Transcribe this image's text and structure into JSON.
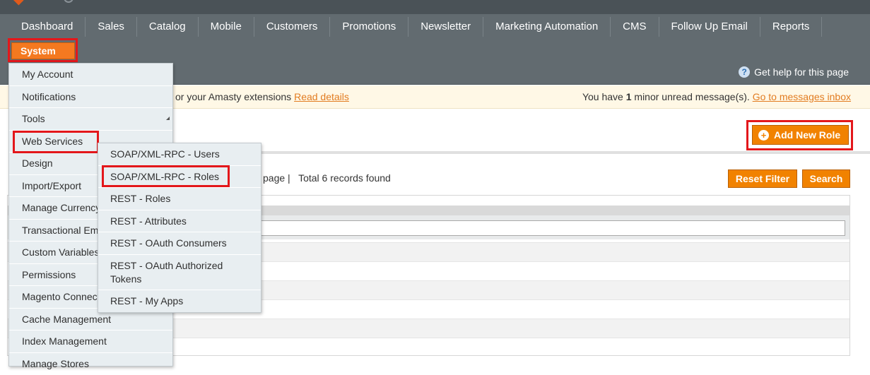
{
  "nav": {
    "items": [
      "Dashboard",
      "Sales",
      "Catalog",
      "Mobile",
      "Customers",
      "Promotions",
      "Newsletter",
      "Marketing Automation",
      "CMS",
      "Follow Up Email",
      "Reports"
    ],
    "system_label": "System",
    "help_label": "Get help for this page",
    "help_icon": "question-icon"
  },
  "message_bar": {
    "left_text": "or your Amasty extensions ",
    "left_link": "Read details",
    "right_prefix": "You have ",
    "right_count": "1",
    "right_suffix": " minor unread message(s). ",
    "right_link": "Go to messages inbox"
  },
  "page": {
    "add_button_label": "Add New Role",
    "pager_text": "page |",
    "records_text": "Total 6 records found",
    "reset_filter_label": "Reset Filter",
    "search_label": "Search"
  },
  "system_menu": {
    "items": [
      "My Account",
      "Notifications",
      "Tools",
      "Web Services",
      "Design",
      "Import/Export",
      "Manage Currency",
      "Transactional Emails",
      "Custom Variables",
      "Permissions",
      "Magento Connect",
      "Cache Management",
      "Index Management",
      "Manage Stores"
    ]
  },
  "web_services_menu": {
    "items": [
      "SOAP/XML-RPC - Users",
      "SOAP/XML-RPC - Roles",
      "REST - Roles",
      "REST - Attributes",
      "REST - OAuth Consumers",
      "REST - OAuth Authorized Tokens",
      "REST - My Apps"
    ]
  },
  "colors": {
    "accent": "#f18200",
    "highlight": "#e3171b",
    "nav_bg": "#626b70"
  }
}
